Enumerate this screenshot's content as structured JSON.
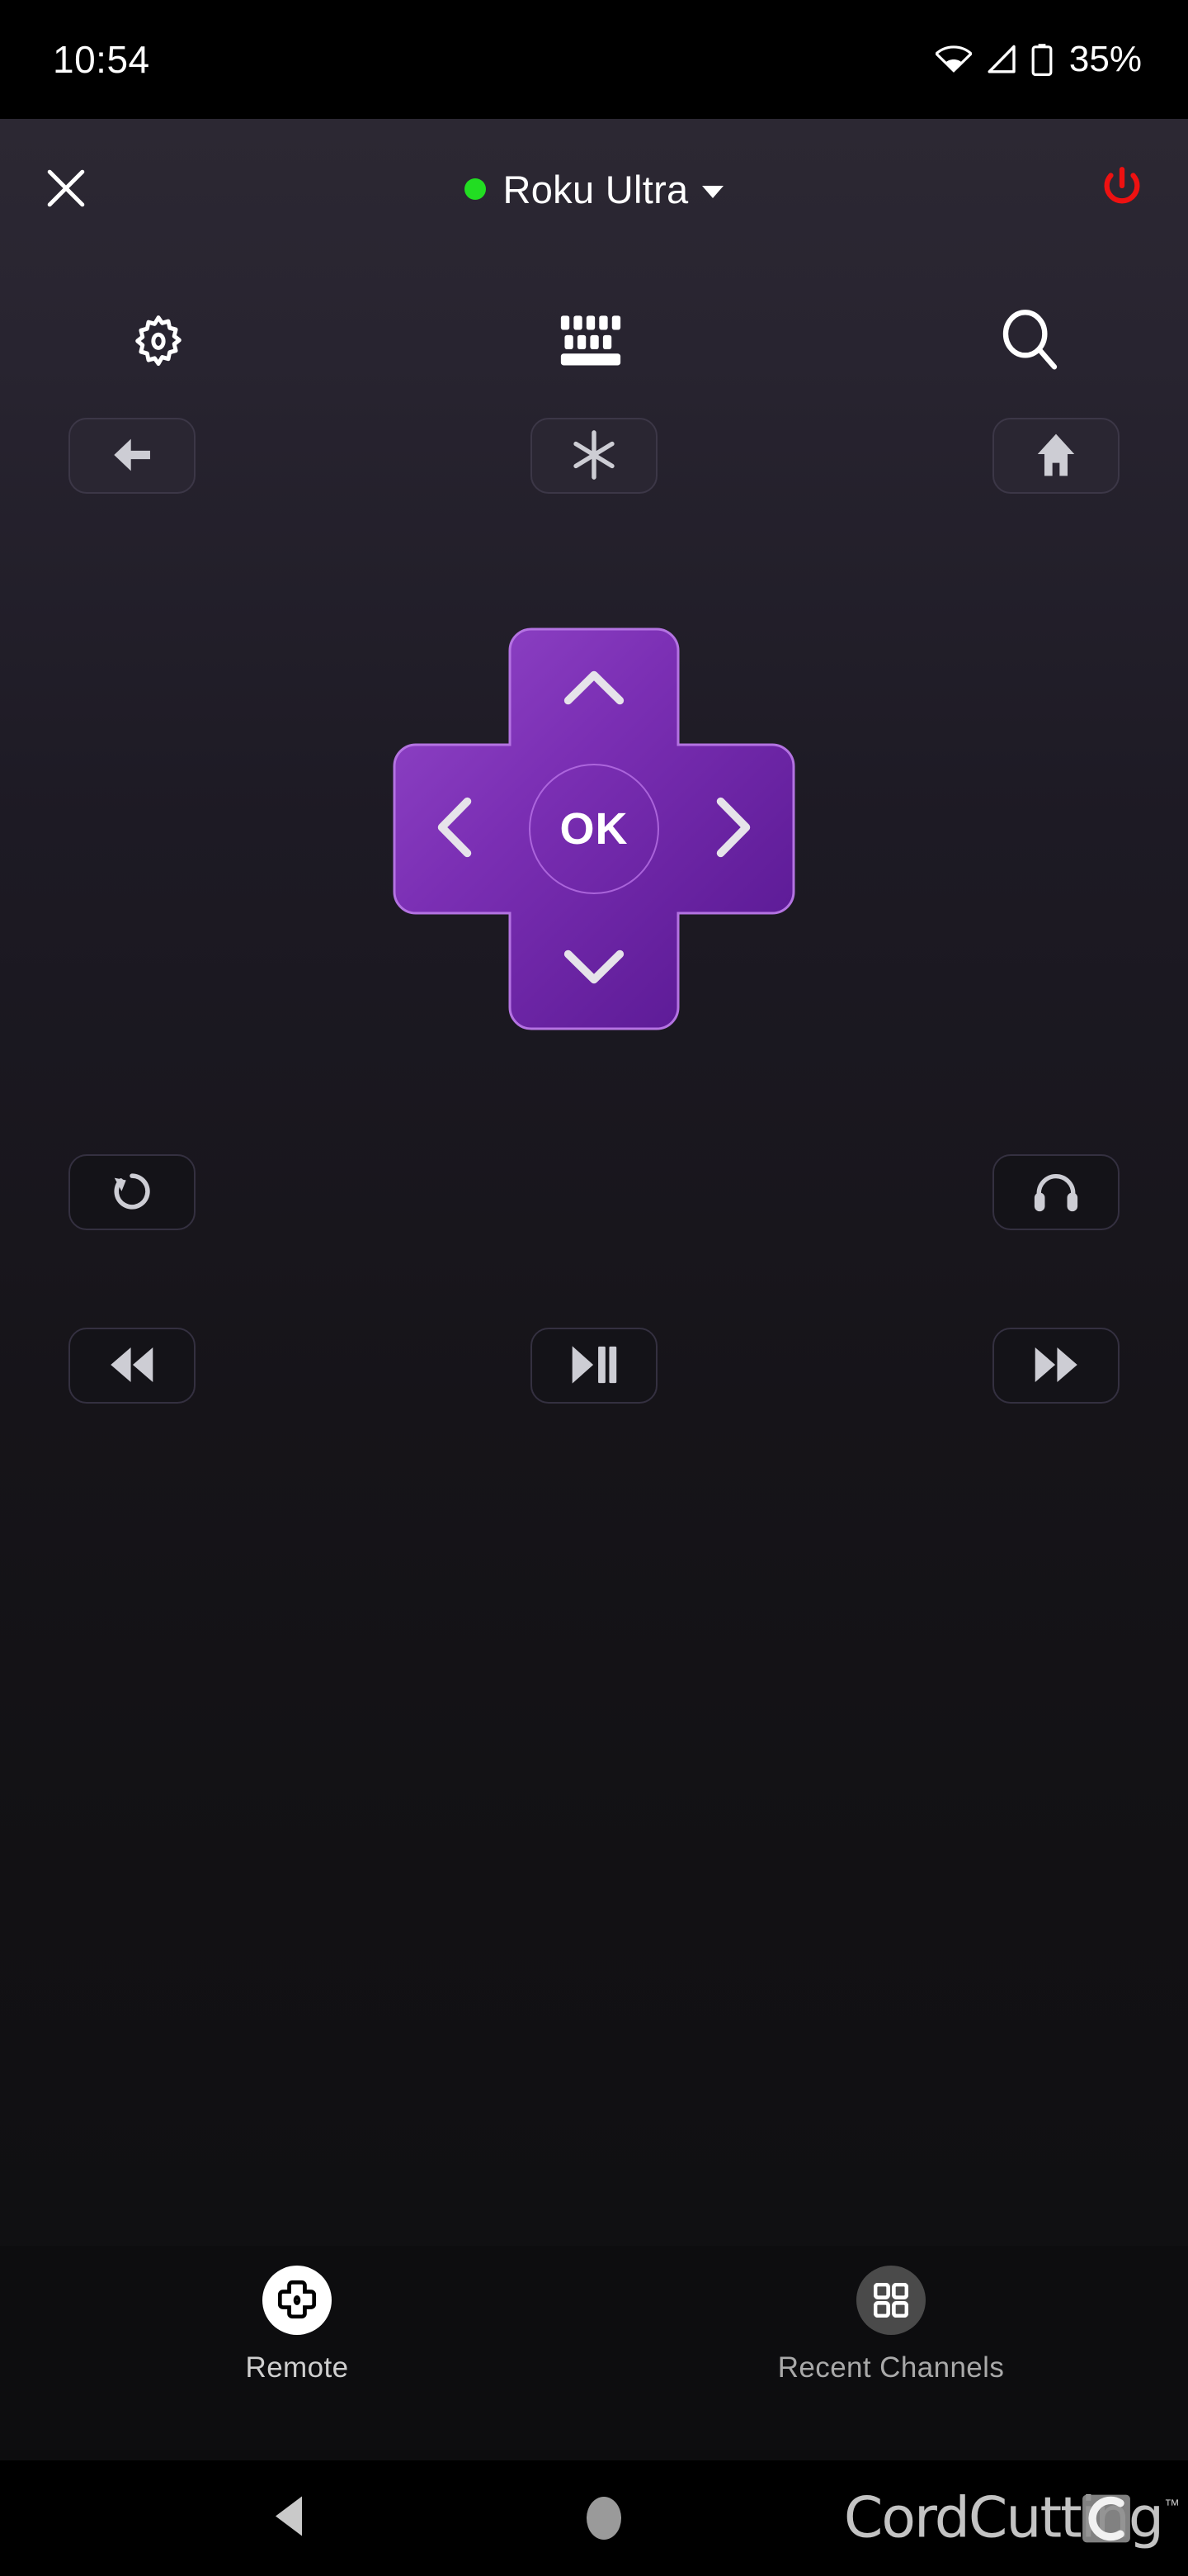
{
  "status_bar": {
    "clock": "10:54",
    "battery_percent": "35%",
    "icons": [
      "wifi-icon",
      "cellular-signal-icon",
      "battery-icon"
    ]
  },
  "header": {
    "close_label": "close-icon",
    "device_name": "Roku Ultra",
    "device_status": "connected",
    "status_dot_color": "#22dd22",
    "dropdown_icon": "chevron-down-icon",
    "power_label": "power-icon",
    "power_color": "#ee1111"
  },
  "quick_icons": [
    {
      "name": "settings-icon",
      "label": "Settings"
    },
    {
      "name": "keyboard-icon",
      "label": "Keyboard"
    },
    {
      "name": "search-icon",
      "label": "Search"
    }
  ],
  "nav_buttons": [
    {
      "name": "back-button",
      "icon": "arrow-left-icon",
      "label": "Back"
    },
    {
      "name": "options-button",
      "icon": "asterisk-icon",
      "label": "Options"
    },
    {
      "name": "home-button",
      "icon": "home-icon",
      "label": "Home"
    }
  ],
  "dpad": {
    "ok_label": "OK",
    "up": "Up",
    "down": "Down",
    "left": "Left",
    "right": "Right",
    "color_light": "#8b3fc0",
    "color_dark": "#5c1a95",
    "border_color": "#b372e0"
  },
  "utility_buttons": [
    {
      "name": "replay-button",
      "icon": "replay-icon",
      "label": "Replay"
    },
    {
      "name": "headphones-button",
      "icon": "headphones-icon",
      "label": "Private Listening"
    }
  ],
  "media_buttons": [
    {
      "name": "rewind-button",
      "icon": "rewind-icon",
      "label": "Rewind"
    },
    {
      "name": "play-pause-button",
      "icon": "play-pause-icon",
      "label": "Play / Pause"
    },
    {
      "name": "fast-forward-button",
      "icon": "fast-forward-icon",
      "label": "Fast Forward"
    }
  ],
  "bottom_nav": [
    {
      "name": "tab-remote",
      "label": "Remote",
      "icon": "dpad-icon",
      "active": true
    },
    {
      "name": "tab-recent-channels",
      "label": "Recent Channels",
      "icon": "grid-icon",
      "active": false
    }
  ],
  "android_nav": {
    "back": "android-back-icon",
    "home": "android-home-icon"
  },
  "watermark": {
    "text": "CordCutting",
    "tm": "™"
  }
}
